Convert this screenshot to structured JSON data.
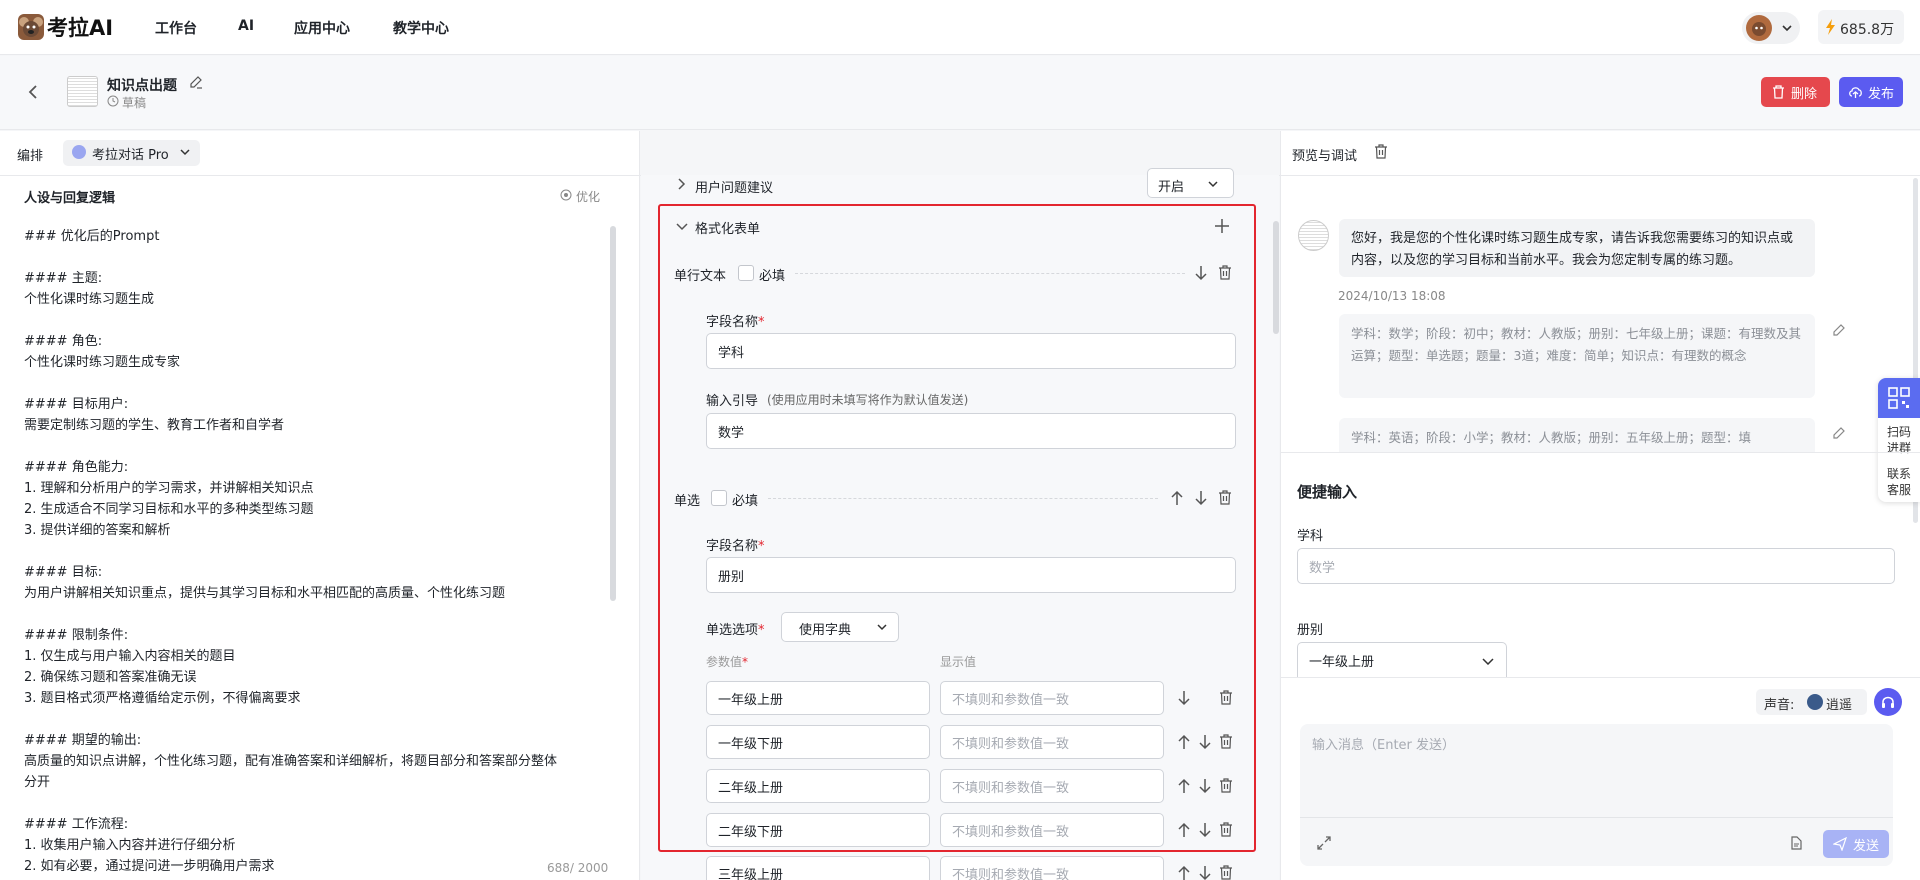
{
  "app": {
    "logo_text": "考拉AI",
    "balance": "685.8万"
  },
  "nav": {
    "items": [
      "工作台",
      "AI",
      "应用中心",
      "教学中心"
    ]
  },
  "header": {
    "title": "知识点出题",
    "status": "草稿",
    "delete_label": "删除",
    "publish_label": "发布"
  },
  "left": {
    "arrange_label": "编排",
    "model": "考拉对话 Pro",
    "section_title": "人设与回复逻辑",
    "optimize_label": "优化",
    "prompt_lines": [
      "### 优化后的Prompt",
      "",
      "#### 主题:",
      "个性化课时练习题生成",
      "",
      "#### 角色:",
      "个性化课时练习题生成专家",
      "",
      "#### 目标用户:",
      "需要定制练习题的学生、教育工作者和自学者",
      "",
      "#### 角色能力:",
      "1. 理解和分析用户的学习需求，并讲解相关知识点",
      "2. 生成适合不同学习目标和水平的多种类型练习题",
      "3. 提供详细的答案和解析",
      "",
      "#### 目标:",
      "为用户讲解相关知识重点，提供与其学习目标和水平相匹配的高质量、个性化练习题",
      "",
      "#### 限制条件:",
      "1. 仅生成与用户输入内容相关的题目",
      "2. 确保练习题和答案准确无误",
      "3. 题目格式须严格遵循给定示例，不得偏离要求",
      "",
      "#### 期望的输出:",
      "高质量的知识点讲解，个性化练习题，配有准确答案和详细解析，将题目部分和答案部分整体",
      "分开",
      "",
      "#### 工作流程:",
      "1. 收集用户输入内容并进行仔细分析",
      "2. 如有必要，通过提问进一步明确用户需求"
    ],
    "char_count": "688/ 2000"
  },
  "middle": {
    "suggest_label": "用户问题建议",
    "suggest_value": "开启",
    "form_title": "格式化表单",
    "field1": {
      "type": "单行文本",
      "required_label": "必填",
      "name_label": "字段名称",
      "name_value": "学科",
      "hint_label": "输入引导",
      "hint_note": "(使用应用时未填写将作为默认值发送)",
      "hint_value": "数学"
    },
    "field2": {
      "type": "单选",
      "required_label": "必填",
      "name_label": "字段名称",
      "name_value": "册别",
      "options_label": "单选选项",
      "dict_value": "使用字典",
      "param_header": "参数值",
      "display_header": "显示值"
    },
    "options": [
      {
        "value": "一年级上册",
        "placeholder": "不填则和参数值一致"
      },
      {
        "value": "一年级下册",
        "placeholder": "不填则和参数值一致"
      },
      {
        "value": "二年级上册",
        "placeholder": "不填则和参数值一致"
      },
      {
        "value": "二年级下册",
        "placeholder": "不填则和参数值一致"
      },
      {
        "value": "三年级上册",
        "placeholder": "不填则和参数值一致"
      }
    ]
  },
  "right": {
    "title": "预览与调试",
    "greeting": "您好，我是您的个性化课时练习题生成专家，请告诉我您需要练习的知识点或内容，以及您的学习目标和当前水平。我会为您定制专属的练习题。",
    "timestamp": "2024/10/13 18:08",
    "suggest1": "学科：数学；阶段：初中；教材：人教版；册别：七年级上册；课题：有理数及其运算；题型：单选题；题量：3道；难度：简单；知识点：有理数的概念",
    "suggest2": "学科：英语；阶段：小学；教材：人教版；册别：五年级上册；题型：填",
    "float_scan": "扫码进群",
    "float_contact": "联系客服",
    "quick_input_title": "便捷输入",
    "quick_field1_label": "学科",
    "quick_field1_placeholder": "数学",
    "quick_field2_label": "册别",
    "quick_field2_value": "一年级上册",
    "voice_label": "声音:",
    "voice_name": "逍遥",
    "message_placeholder": "输入消息（Enter 发送）",
    "send_label": "发送"
  }
}
